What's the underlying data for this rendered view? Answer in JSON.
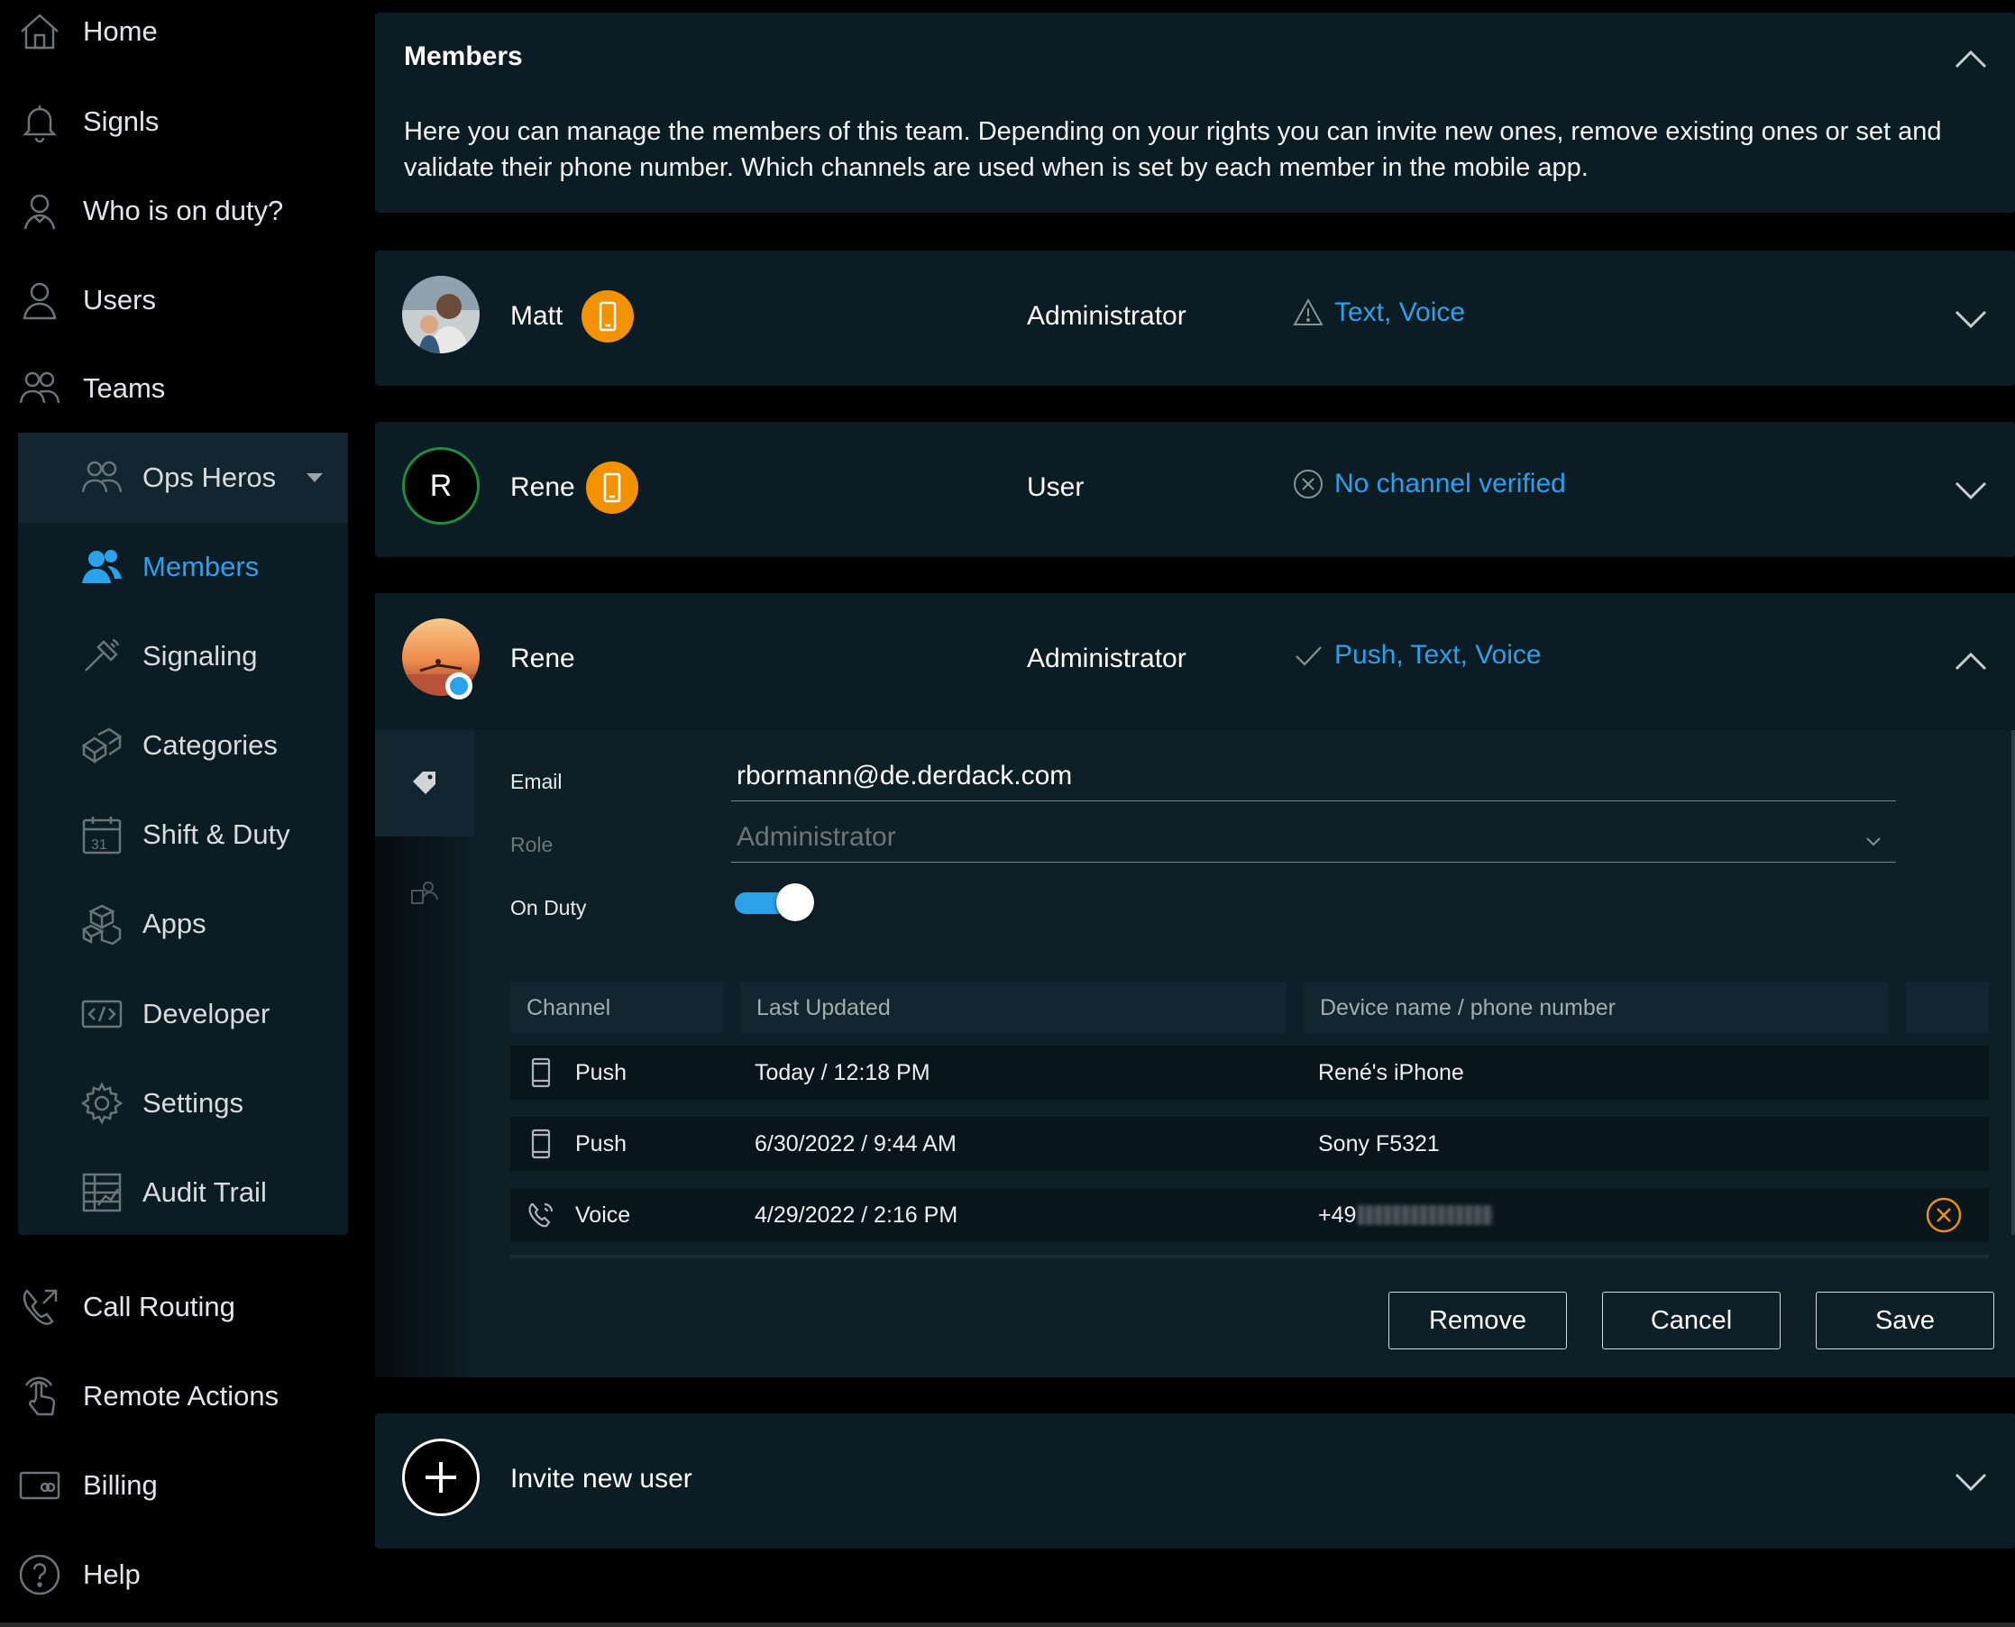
{
  "sidebar": {
    "items": [
      {
        "label": "Home",
        "icon": "home-icon"
      },
      {
        "label": "Signls",
        "icon": "bell-icon"
      },
      {
        "label": "Who is on duty?",
        "icon": "person-duty-icon"
      },
      {
        "label": "Users",
        "icon": "user-icon"
      },
      {
        "label": "Teams",
        "icon": "teams-icon"
      }
    ],
    "team": {
      "label": "Ops Heros",
      "icon": "team-icon"
    },
    "team_items": [
      {
        "label": "Members",
        "icon": "members-icon",
        "active": true
      },
      {
        "label": "Signaling",
        "icon": "signaling-icon"
      },
      {
        "label": "Categories",
        "icon": "categories-icon"
      },
      {
        "label": "Shift & Duty",
        "icon": "calendar-icon"
      },
      {
        "label": "Apps",
        "icon": "apps-icon"
      },
      {
        "label": "Developer",
        "icon": "code-icon"
      },
      {
        "label": "Settings",
        "icon": "gear-icon"
      },
      {
        "label": "Audit Trail",
        "icon": "audit-icon"
      }
    ],
    "bottom_items": [
      {
        "label": "Call Routing",
        "icon": "call-routing-icon"
      },
      {
        "label": "Remote Actions",
        "icon": "remote-actions-icon"
      },
      {
        "label": "Billing",
        "icon": "billing-icon"
      },
      {
        "label": "Help",
        "icon": "help-icon"
      }
    ]
  },
  "members_panel": {
    "title": "Members",
    "description": "Here you can manage the members of this team. Depending on your rights you can invite new ones, remove existing ones or set and validate their phone number. Which channels are used when is set by each member in the mobile app."
  },
  "members": [
    {
      "name": "Matt",
      "role": "Administrator",
      "channels": "Text, Voice",
      "status_icon": "warning-icon"
    },
    {
      "name": "Rene",
      "initial": "R",
      "role": "User",
      "channels": "No channel verified",
      "status_icon": "x-circle-icon"
    },
    {
      "name": "Rene",
      "role": "Administrator",
      "channels": "Push, Text, Voice",
      "status_icon": "check-icon"
    }
  ],
  "detail": {
    "email_label": "Email",
    "email_value": "rbormann@de.derdack.com",
    "role_label": "Role",
    "role_value": "Administrator",
    "onduty_label": "On Duty",
    "on_duty": true,
    "table": {
      "headers": [
        "Channel",
        "Last Updated",
        "Device name / phone number"
      ],
      "rows": [
        {
          "channel": "Push",
          "icon": "phone-icon",
          "updated": "Today / 12:18 PM",
          "device": "René's iPhone"
        },
        {
          "channel": "Push",
          "icon": "phone-icon",
          "updated": "6/30/2022 / 9:44 AM",
          "device": "Sony F5321"
        },
        {
          "channel": "Voice",
          "icon": "voice-icon",
          "updated": "4/29/2022 / 2:16 PM",
          "device": "+49"
        }
      ]
    },
    "buttons": {
      "remove": "Remove",
      "cancel": "Cancel",
      "save": "Save"
    }
  },
  "invite": {
    "label": "Invite new user"
  },
  "colors": {
    "accent": "#2ba1ea",
    "badge": "#f39200",
    "panel": "#0c1c24",
    "background": "#000000"
  }
}
